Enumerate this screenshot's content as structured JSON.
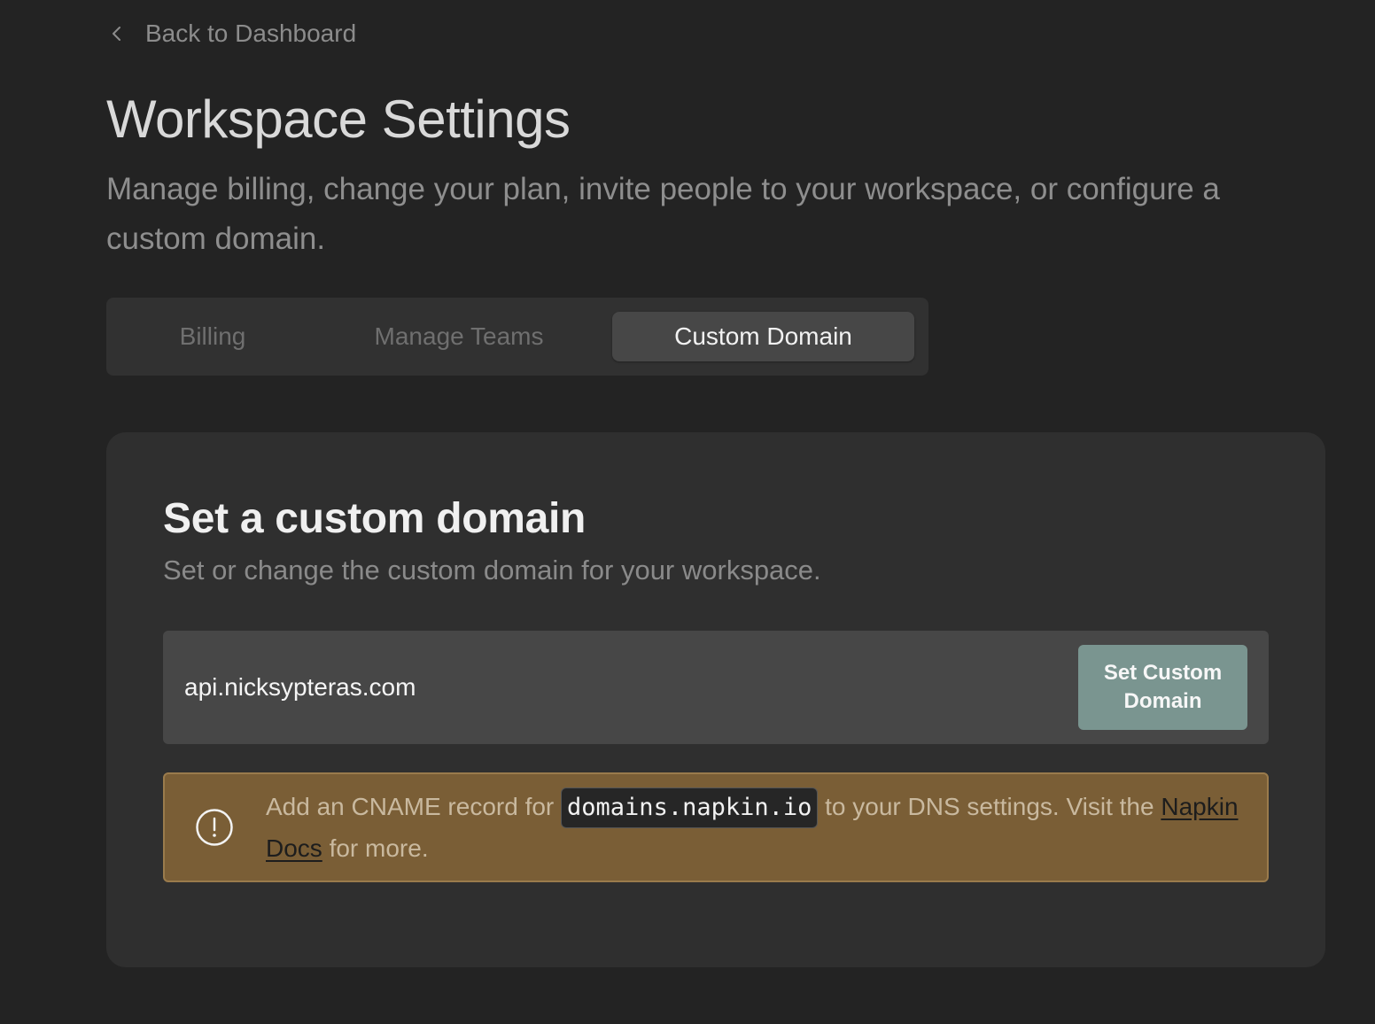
{
  "nav": {
    "back_label": "Back to Dashboard"
  },
  "header": {
    "title": "Workspace Settings",
    "subtitle": "Manage billing, change your plan, invite people to your workspace, or configure a custom domain."
  },
  "tabs": [
    {
      "label": "Billing",
      "active": false
    },
    {
      "label": "Manage Teams",
      "active": false
    },
    {
      "label": "Custom Domain",
      "active": true
    }
  ],
  "custom_domain": {
    "title": "Set a custom domain",
    "subtitle": "Set or change the custom domain for your workspace.",
    "input_value": "api.nicksypteras.com",
    "button_label": "Set Custom Domain",
    "notice": {
      "icon": "alert-circle-icon",
      "text_before": "Add an CNAME record for ",
      "code": "domains.napkin.io",
      "text_middle": " to your DNS settings. Visit the ",
      "link_label": "Napkin Docs",
      "text_after": " for more."
    }
  },
  "colors": {
    "background": "#232323",
    "card": "#2f2f2f",
    "button_accent": "#7a9590",
    "notice_bg": "#7a5e36"
  }
}
